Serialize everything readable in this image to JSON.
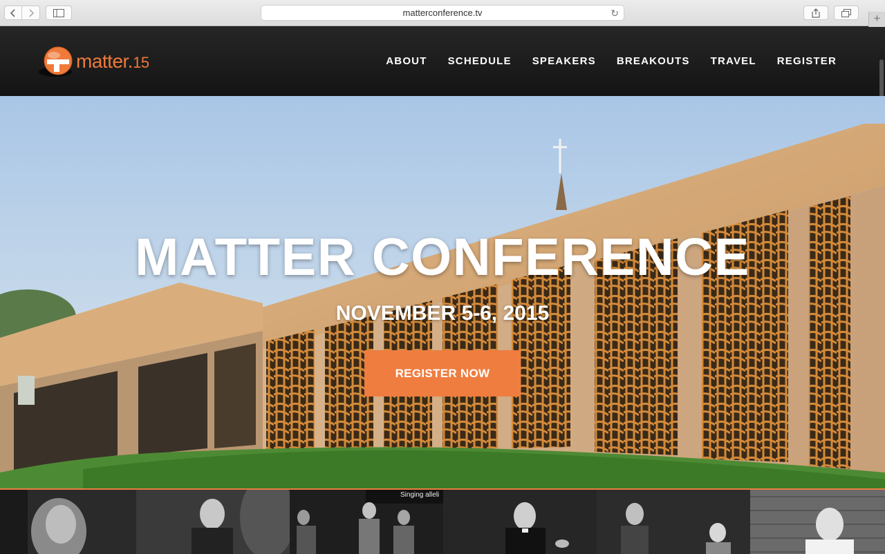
{
  "browser": {
    "url": "matterconference.tv"
  },
  "header": {
    "logo_word": "matter.",
    "logo_num": "15",
    "nav": [
      {
        "label": "ABOUT"
      },
      {
        "label": "SCHEDULE"
      },
      {
        "label": "SPEAKERS"
      },
      {
        "label": "BREAKOUTS"
      },
      {
        "label": "TRAVEL"
      },
      {
        "label": "REGISTER"
      }
    ]
  },
  "hero": {
    "title": "MATTER CONFERENCE",
    "date": "NOVEMBER 5-6, 2015",
    "cta": "REGISTER NOW"
  },
  "strip": {
    "caption": "Singing alleli"
  },
  "colors": {
    "accent": "#ef7d40",
    "header_bg": "#1c1c1c",
    "text_on_dark": "#ffffff"
  },
  "icons": [
    "back-icon",
    "forward-icon",
    "sidebar-icon",
    "reload-icon",
    "share-icon",
    "tabs-icon",
    "new-tab-icon"
  ]
}
